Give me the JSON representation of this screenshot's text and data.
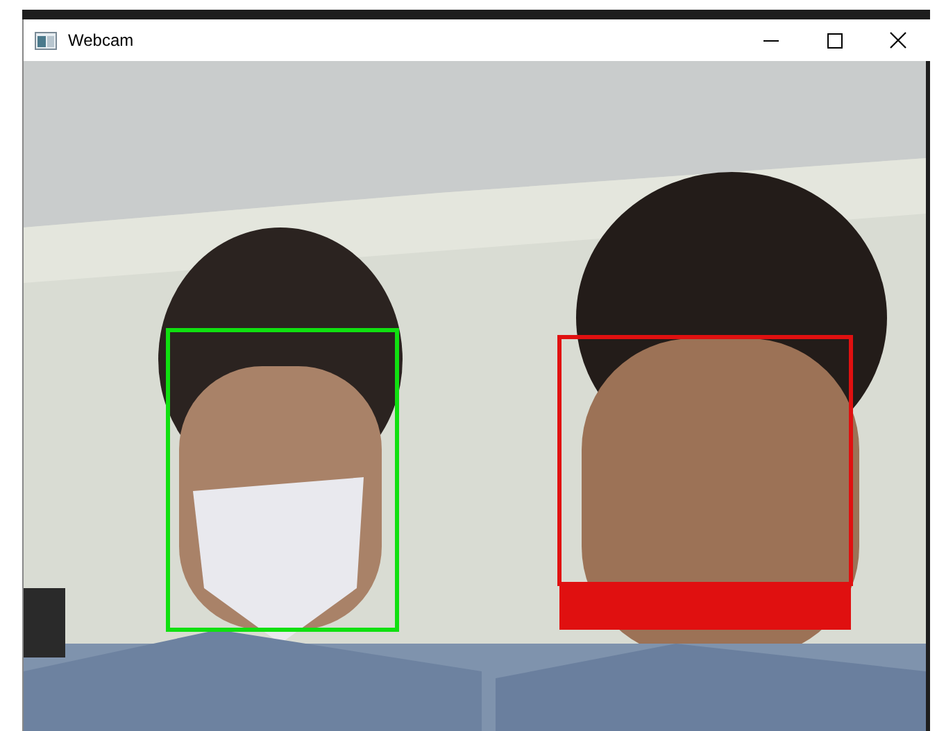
{
  "window": {
    "title": "Webcam"
  }
}
